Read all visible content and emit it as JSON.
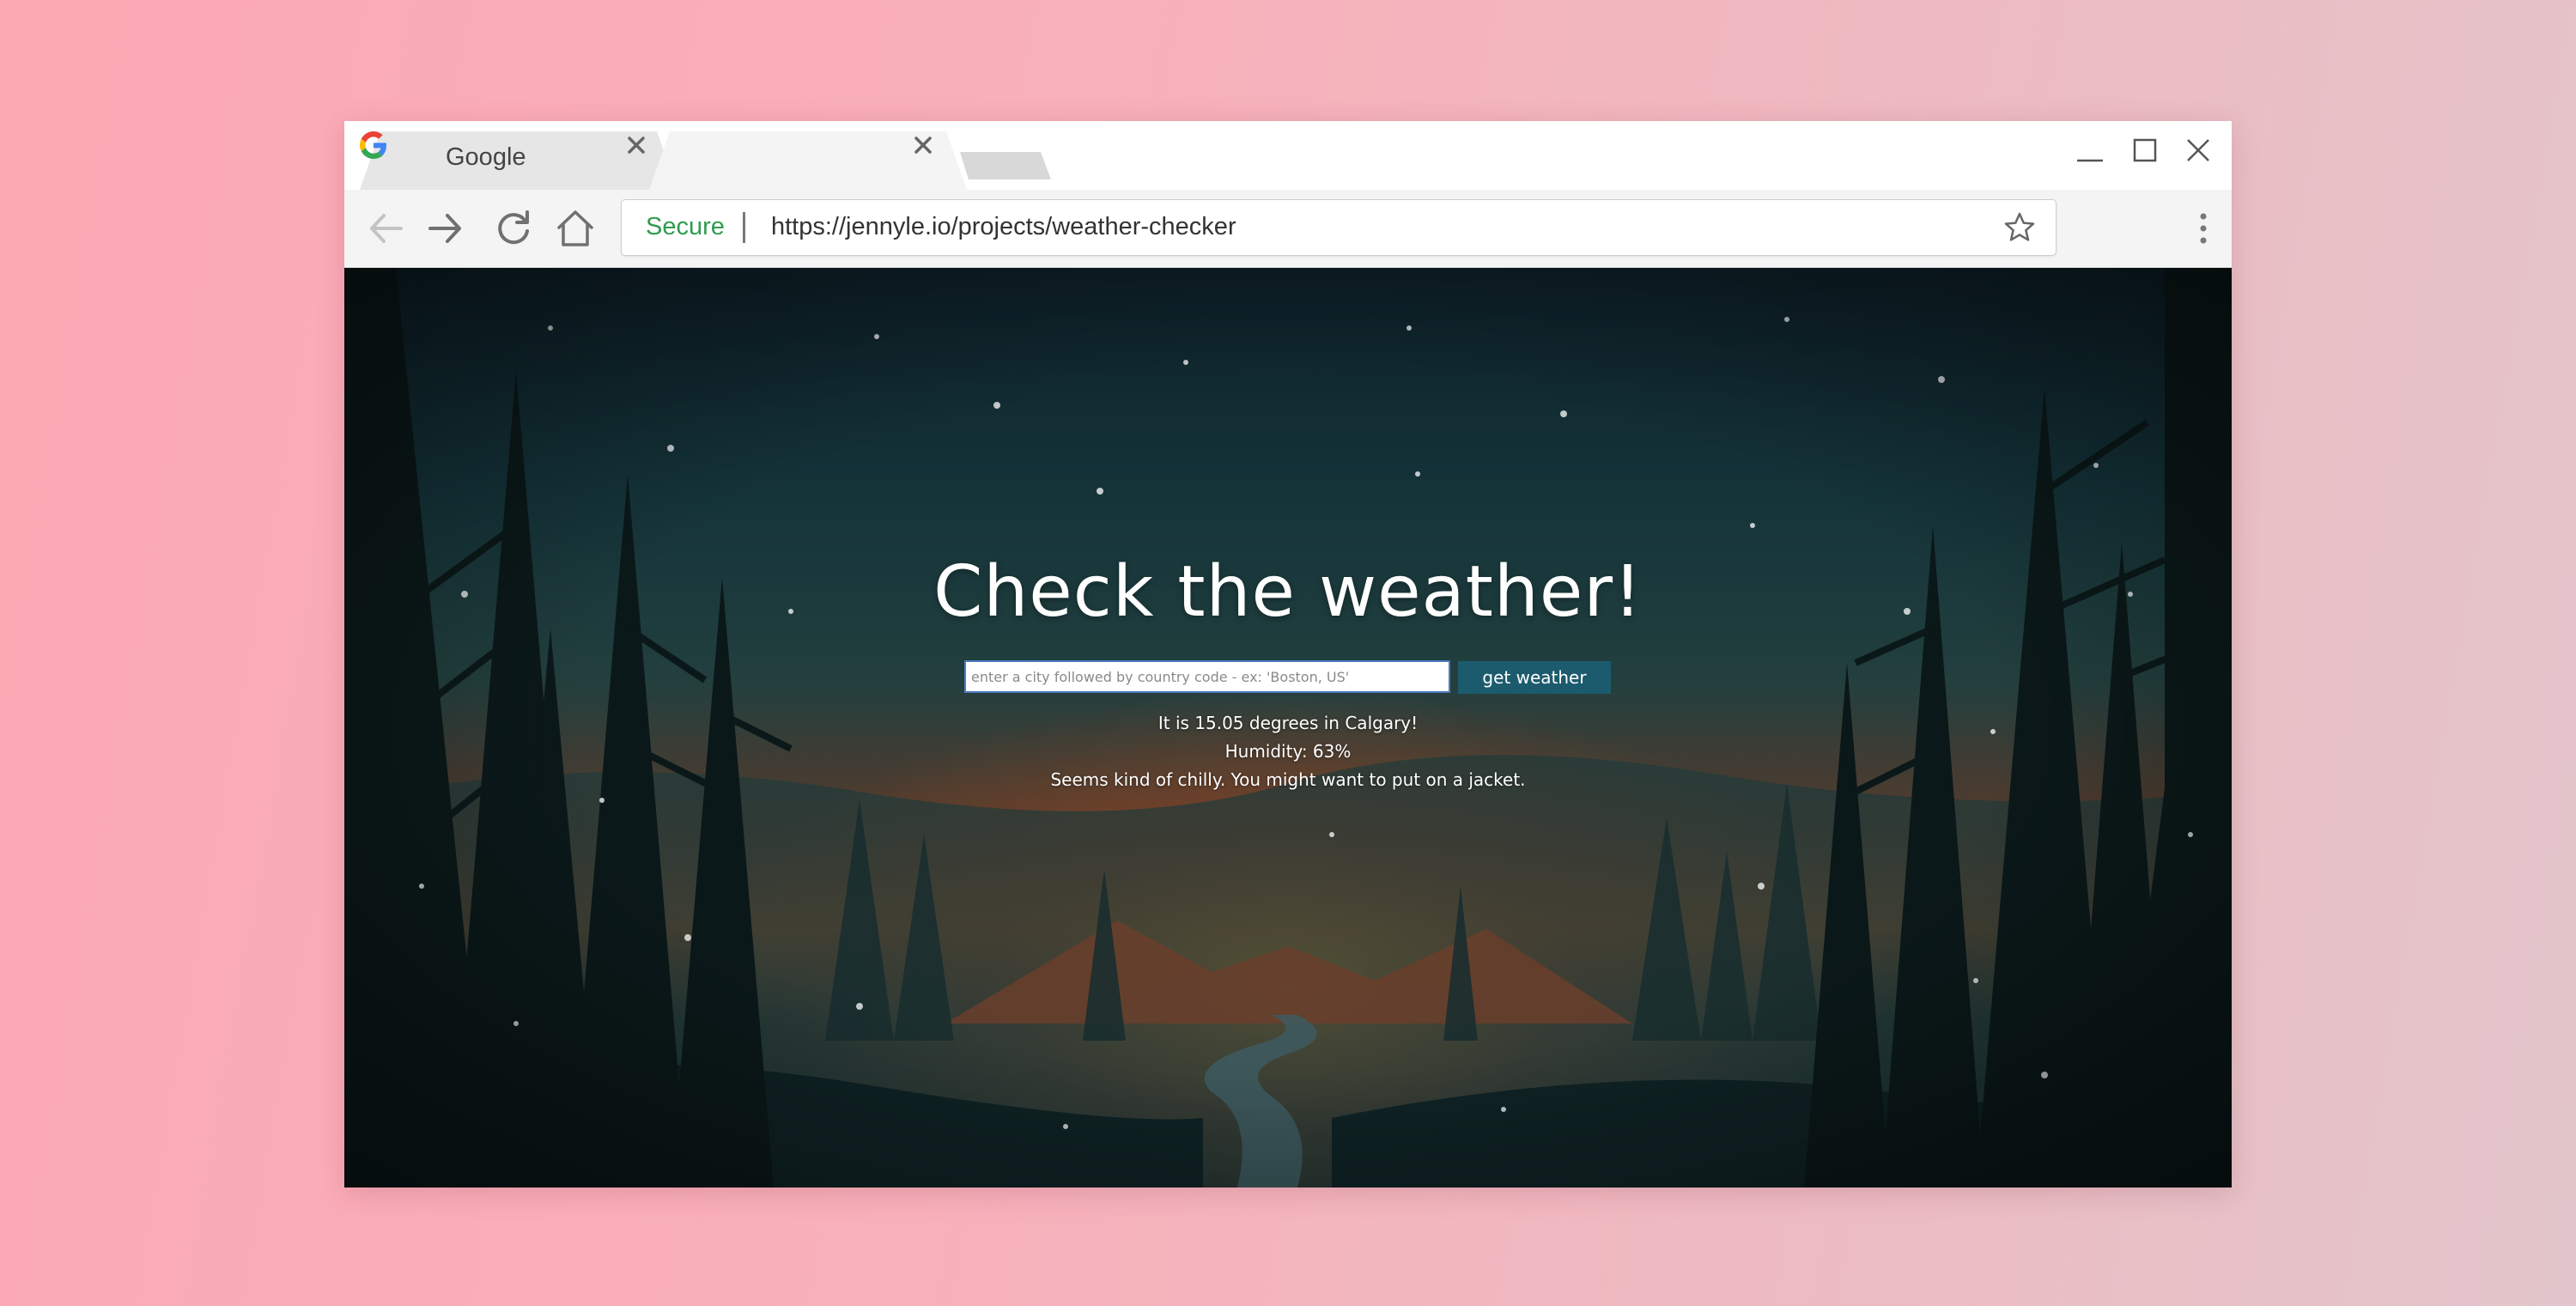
{
  "browser": {
    "tabs": [
      {
        "title": "Google",
        "favicon": "google-g-icon",
        "close_icon": "close-icon"
      },
      {
        "title": "",
        "close_icon": "close-icon"
      }
    ],
    "window_controls": [
      "minimize-icon",
      "maximize-icon",
      "close-icon"
    ],
    "toolbar": {
      "icons": [
        "back-arrow-icon",
        "forward-arrow-icon",
        "reload-icon",
        "home-icon",
        "star-icon",
        "menu-dots-icon"
      ]
    },
    "omnibox": {
      "secure_label": "Secure",
      "url": "https://jennyle.io/projects/weather-checker"
    }
  },
  "page": {
    "heading": "Check the weather!",
    "search": {
      "value": "",
      "placeholder": "enter a city followed by country code - ex: 'Boston, US'"
    },
    "button_label": "get weather",
    "results": {
      "temperature": "It is 15.05 degrees in Calgary!",
      "humidity": "Humidity: 63%",
      "advice": "Seems kind of chilly. You might want to put on a jacket."
    }
  },
  "colors": {
    "background_pink": "#fca9b4",
    "secure_green": "#2e9c4e",
    "button_teal": "#1c5b6e",
    "input_border": "#4a7cc0",
    "google_blue": "#4285F4",
    "google_red": "#EA4335",
    "google_yellow": "#FBBC05",
    "google_green": "#34A853"
  }
}
